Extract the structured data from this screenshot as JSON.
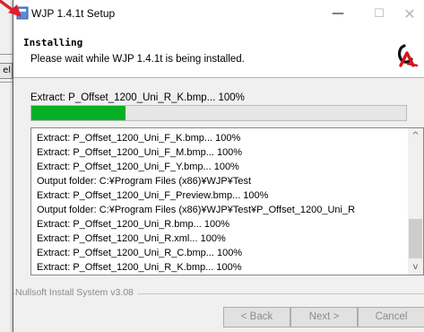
{
  "window": {
    "title": "WJP 1.4.1t Setup",
    "controls": {
      "minimize": "—",
      "maximize": "☐",
      "close": "✕"
    }
  },
  "background_app": {
    "tab_label": "el"
  },
  "header": {
    "title": "Installing",
    "subtitle": "Please wait while WJP 1.4.1t is being installed."
  },
  "status": {
    "current": "Extract: P_Offset_1200_Uni_R_K.bmp... 100%",
    "progress_percent": 25
  },
  "log": {
    "lines": [
      "Extract: P_Offset_1200_Uni_F_K.bmp... 100%",
      "Extract: P_Offset_1200_Uni_F_M.bmp... 100%",
      "Extract: P_Offset_1200_Uni_F_Y.bmp... 100%",
      "Output folder: C:¥Program Files (x86)¥WJP¥Test",
      "Extract: P_Offset_1200_Uni_F_Preview.bmp... 100%",
      "Output folder: C:¥Program Files (x86)¥WJP¥Test¥P_Offset_1200_Uni_R",
      "Extract: P_Offset_1200_Uni_R.bmp... 100%",
      "Extract: P_Offset_1200_Uni_R.xml... 100%",
      "Extract: P_Offset_1200_Uni_R_C.bmp... 100%",
      "Extract: P_Offset_1200_Uni_R_K.bmp... 100%"
    ],
    "scroll_up": "^",
    "scroll_down": "v"
  },
  "footer": {
    "brand": "Nullsoft Install System v3.08",
    "back_label": "< Back",
    "next_label": "Next >",
    "cancel_label": "Cancel"
  },
  "colors": {
    "progress_fill": "#06b025",
    "arrow": "#e0202a",
    "logo_red": "#d8101c"
  },
  "icons": {
    "app": "installer-app-icon",
    "logo": "brand-logo-icon",
    "arrow": "red-arrow-annotation-icon"
  }
}
